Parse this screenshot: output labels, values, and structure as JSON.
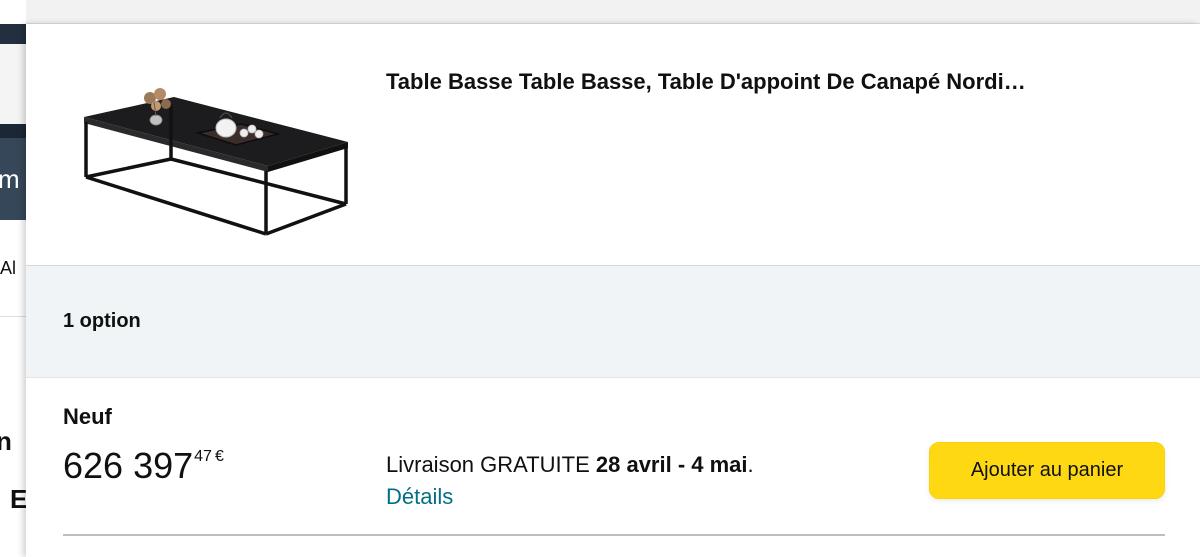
{
  "background_page": {
    "nav_fragment": "m",
    "fragments": [
      "Al",
      "n",
      "E"
    ]
  },
  "product": {
    "title": "Table Basse Table Basse, Table D'appoint De Canapé Nordi…",
    "image_icon": "coffee-table-image"
  },
  "options": {
    "count_label": "1 option"
  },
  "offer": {
    "condition": "Neuf",
    "price_whole": "626 397",
    "price_fraction": "47",
    "price_symbol": "€",
    "delivery_prefix": "Livraison GRATUITE",
    "delivery_dates": "28 avril - 4 mai",
    "delivery_suffix": ".",
    "details_link": "Détails",
    "add_to_cart_label": "Ajouter au panier"
  },
  "colors": {
    "add_button": "#ffd814",
    "link": "#007185",
    "options_bar": "#f0f4f6",
    "nav_dark": "#232f3e"
  }
}
